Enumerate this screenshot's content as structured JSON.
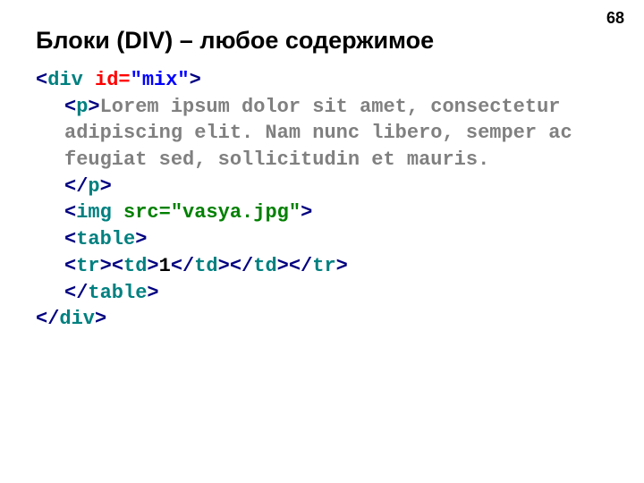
{
  "pageNumber": "68",
  "title": "Блоки (DIV) – любое содержимое",
  "code": {
    "divOpen": {
      "lt": "<",
      "tag": "div",
      "sp": " ",
      "attr": "id=",
      "val": "\"mix\"",
      "gt": ">"
    },
    "pOpen": {
      "lt": "<",
      "tag": "p",
      "gt": ">"
    },
    "lorem": "Lorem ipsum dolor sit amet, consectetur adipiscing elit. Nam nunc libero, semper ac feugiat sed, sollicitudin et mauris.",
    "pClose": {
      "lt": "</",
      "tag": "p",
      "gt": ">"
    },
    "img": {
      "lt": "<",
      "tag": "img",
      "sp": " ",
      "attr": "src=",
      "val": "\"vasya.jpg\"",
      "gt": ">"
    },
    "tableOpen": {
      "lt": "<",
      "tag": "table",
      "gt": ">"
    },
    "trOpen": {
      "lt": "<",
      "tag": "tr",
      "gt": ">"
    },
    "tdOpen": {
      "lt": "<",
      "tag": "td",
      "gt": ">"
    },
    "cell": "1",
    "tdClose": {
      "lt": "</",
      "tag": "td",
      "gt": ">"
    },
    "tdClose2": {
      "lt": "</",
      "tag": "td",
      "gt": ">"
    },
    "trClose": {
      "lt": "</",
      "tag": "tr",
      "gt": ">"
    },
    "tableClose": {
      "lt": "</",
      "tag": "table",
      "gt": ">"
    },
    "divClose": {
      "lt": "</",
      "tag": "div",
      "gt": ">"
    }
  }
}
